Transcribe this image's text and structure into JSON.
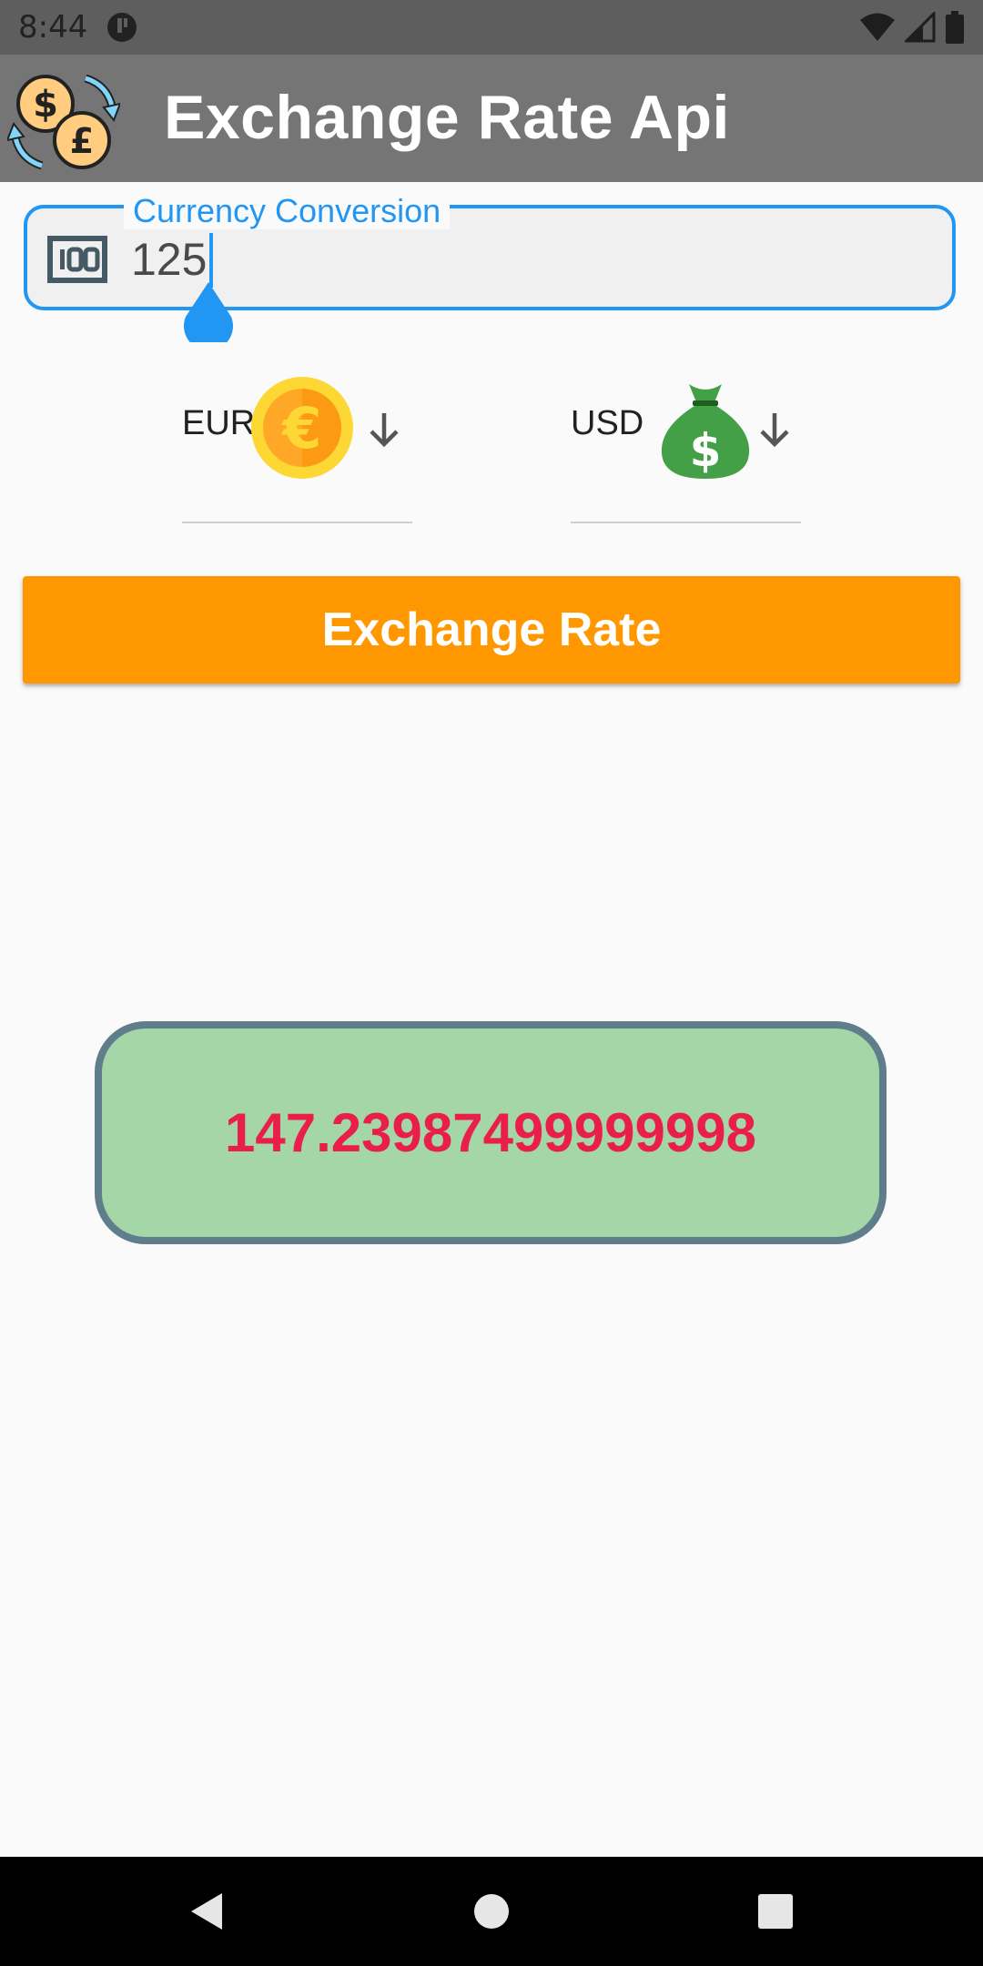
{
  "status_bar": {
    "time": "8:44",
    "icons": [
      "app-notification-icon",
      "wifi-icon",
      "signal-icon",
      "battery-icon"
    ]
  },
  "app_bar": {
    "title": "Exchange Rate Api",
    "logo_icon": "currency-exchange-icon",
    "background": "#757575"
  },
  "input": {
    "label": "Currency Conversion",
    "value": "125",
    "icon": "banknote-100-icon",
    "accent": "#2196f3"
  },
  "from_currency": {
    "code": "EUR",
    "icon": "euro-coin-icon"
  },
  "to_currency": {
    "code": "USD",
    "icon": "money-bag-icon"
  },
  "exchange_button": {
    "label": "Exchange Rate",
    "color": "#ff9800"
  },
  "result": {
    "value": "147.23987499999998",
    "text_color": "#e91e4a",
    "background": "#a5d6a7",
    "border": "#607d8b"
  },
  "nav_bar": {
    "buttons": [
      "back-icon",
      "home-icon",
      "recents-icon"
    ]
  }
}
